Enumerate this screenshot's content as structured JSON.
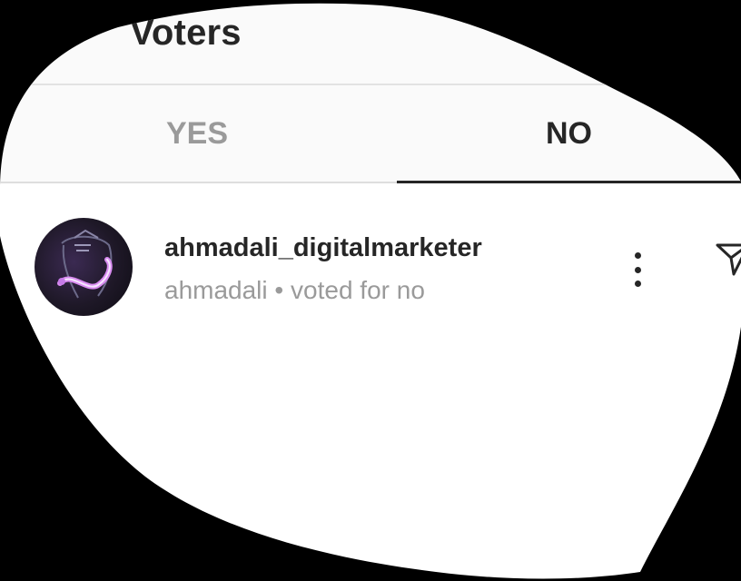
{
  "header": {
    "title": "Voters"
  },
  "tabs": [
    {
      "label": "YES",
      "active": false
    },
    {
      "label": "NO",
      "active": true
    }
  ],
  "voters": [
    {
      "username": "ahmadali_digitalmarketer",
      "name": "ahmadali",
      "vote": "voted for no",
      "separator": "•"
    }
  ],
  "icons": {
    "more": "vertical-dots-icon",
    "send": "paper-plane-icon"
  },
  "colors": {
    "text": "#262626",
    "muted": "#9a9a9a",
    "background": "#ffffff",
    "header_bg": "#fafafa"
  }
}
